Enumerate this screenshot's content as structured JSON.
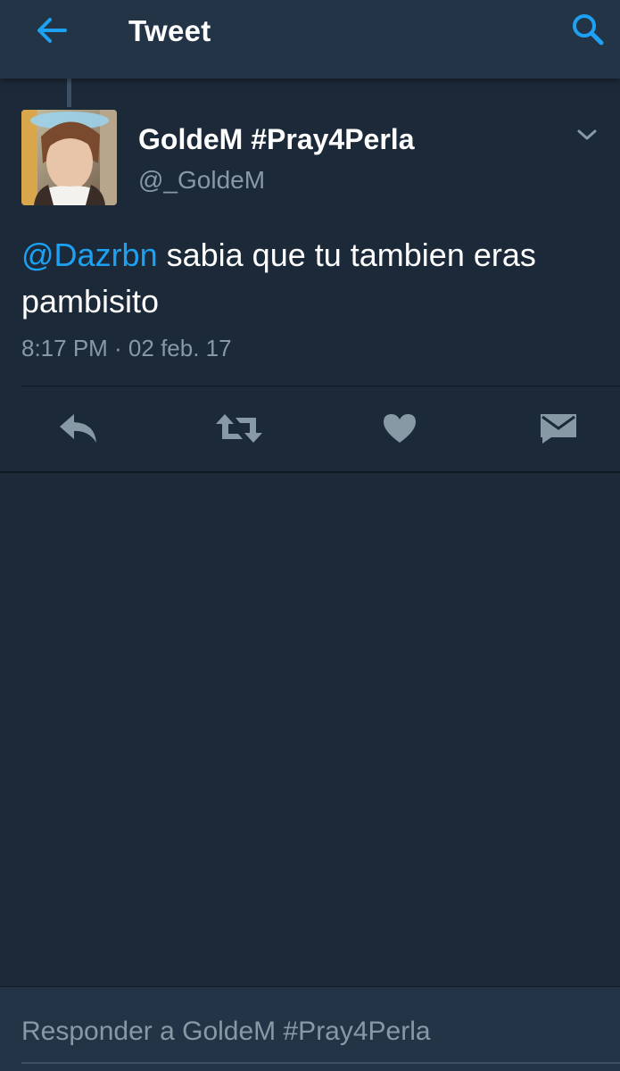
{
  "header": {
    "title": "Tweet",
    "back_icon": "arrow-left-icon",
    "search_icon": "search-icon"
  },
  "tweet": {
    "author": {
      "display_name": "GoldeM #Pray4Perla",
      "handle": "@_GoldeM"
    },
    "text": {
      "mention": "@Dazrbn",
      "body": " sabia que tu tambien eras pambisito"
    },
    "timestamp": "8:17 PM · 02 feb. 17",
    "actions": [
      {
        "name": "reply",
        "icon": "reply-icon"
      },
      {
        "name": "retweet",
        "icon": "retweet-icon"
      },
      {
        "name": "like",
        "icon": "heart-icon"
      },
      {
        "name": "direct-message",
        "icon": "envelope-icon"
      }
    ]
  },
  "reply": {
    "placeholder": "Responder a GoldeM #Pray4Perla"
  },
  "colors": {
    "background": "#1c2938",
    "bar": "#243447",
    "accent": "#1da1f2",
    "secondary_text": "#8899a6",
    "icon": "#8899a6"
  }
}
